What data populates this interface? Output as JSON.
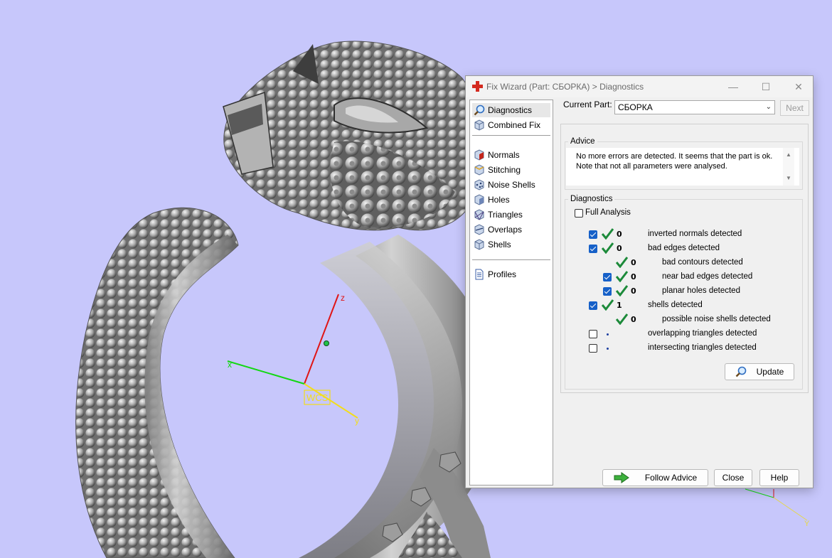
{
  "viewport": {
    "wcs_label": "WCS",
    "axis_x": "x",
    "axis_y": "y",
    "axis_z": "z",
    "corner_axis_y": "Y"
  },
  "dialog": {
    "title": "Fix Wizard (Part: СБОРКА) > Diagnostics",
    "sidebar": {
      "group1": [
        {
          "label": "Diagnostics",
          "icon": "magnifier-icon",
          "selected": true
        },
        {
          "label": "Combined Fix",
          "icon": "cube-icon"
        }
      ],
      "group2": [
        {
          "label": "Normals",
          "icon": "normals-cube-icon"
        },
        {
          "label": "Stitching",
          "icon": "stitching-cube-icon"
        },
        {
          "label": "Noise Shells",
          "icon": "noise-shells-icon"
        },
        {
          "label": "Holes",
          "icon": "holes-cube-icon"
        },
        {
          "label": "Triangles",
          "icon": "triangles-cube-icon"
        },
        {
          "label": "Overlaps",
          "icon": "overlaps-cube-icon"
        },
        {
          "label": "Shells",
          "icon": "shells-cube-icon"
        }
      ],
      "group3": [
        {
          "label": "Profiles",
          "icon": "document-icon"
        }
      ]
    },
    "current_part_label": "Current Part:",
    "current_part_value": "СБОРКА",
    "next_label": "Next",
    "advice": {
      "legend": "Advice",
      "line1": "No more errors are detected. It seems that the part is ok.",
      "line2": "Note that not all parameters were analysed."
    },
    "diagnostics": {
      "legend": "Diagnostics",
      "full_analysis_label": "Full Analysis",
      "full_analysis_checked": false,
      "rows": [
        {
          "checkbox": true,
          "checked": true,
          "status": "ok",
          "count": "0",
          "text": "inverted normals detected",
          "indent": 0
        },
        {
          "checkbox": true,
          "checked": true,
          "status": "ok",
          "count": "0",
          "text": "bad edges detected",
          "indent": 0
        },
        {
          "checkbox": false,
          "checked": false,
          "status": "ok",
          "count": "0",
          "text": "bad contours detected",
          "indent": 1
        },
        {
          "checkbox": true,
          "checked": true,
          "status": "ok",
          "count": "0",
          "text": "near bad edges detected",
          "indent": 1
        },
        {
          "checkbox": true,
          "checked": true,
          "status": "ok",
          "count": "0",
          "text": "planar holes detected",
          "indent": 1
        },
        {
          "checkbox": true,
          "checked": true,
          "status": "ok",
          "count": "1",
          "text": "shells detected",
          "indent": 0
        },
        {
          "checkbox": false,
          "checked": false,
          "status": "ok",
          "count": "0",
          "text": "possible noise shells detected",
          "indent": 1
        },
        {
          "checkbox": true,
          "checked": false,
          "status": "none",
          "count": "",
          "text": "overlapping triangles detected",
          "indent": 0
        },
        {
          "checkbox": true,
          "checked": false,
          "status": "none",
          "count": "",
          "text": "intersecting triangles detected",
          "indent": 0
        }
      ]
    },
    "update_label": "Update",
    "follow_advice_label": "Follow Advice",
    "close_label": "Close",
    "help_label": "Help",
    "colors": {
      "accent": "#1660c8",
      "ok_green": "#1c8a3a",
      "viewport_bg": "#c7c7fb"
    }
  }
}
